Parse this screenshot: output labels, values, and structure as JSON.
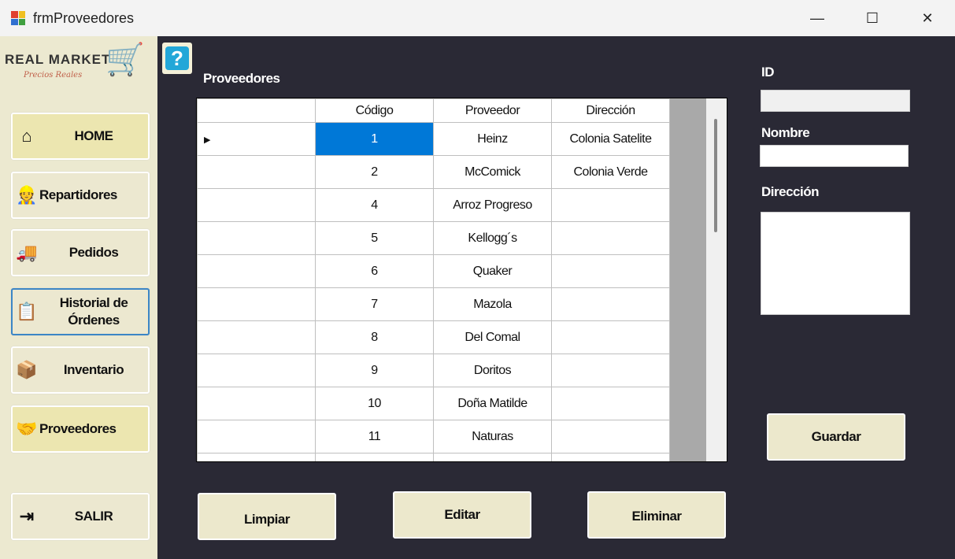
{
  "window": {
    "title": "frmProveedores",
    "minimize": "—",
    "maximize": "☐",
    "close": "✕"
  },
  "logo": {
    "brand": "REAL MARKET",
    "tagline": "Precios Reales"
  },
  "sidebar": {
    "items": [
      {
        "label": "HOME",
        "icon": "⌂"
      },
      {
        "label": "Repartidores",
        "icon": "👷"
      },
      {
        "label": "Pedidos",
        "icon": "🚚"
      },
      {
        "label": "Historial de Órdenes",
        "icon": "📋"
      },
      {
        "label": "Inventario",
        "icon": "📦"
      },
      {
        "label": "Proveedores",
        "icon": "🤝"
      },
      {
        "label": "SALIR",
        "icon": "⇥"
      }
    ]
  },
  "help": {
    "icon": "?"
  },
  "grid": {
    "title": "Proveedores",
    "columns": [
      "",
      "Código",
      "Proveedor",
      "Dirección"
    ],
    "rows": [
      [
        "1",
        "Heinz",
        "Colonia Satelite"
      ],
      [
        "2",
        "McComick",
        "Colonia Verde"
      ],
      [
        "4",
        "Arroz Progreso",
        ""
      ],
      [
        "5",
        "Kellogg´s",
        ""
      ],
      [
        "6",
        "Quaker",
        ""
      ],
      [
        "7",
        "Mazola",
        ""
      ],
      [
        "8",
        "Del Comal",
        ""
      ],
      [
        "9",
        "Doritos",
        ""
      ],
      [
        "10",
        "Doña Matilde",
        ""
      ],
      [
        "11",
        "Naturas",
        ""
      ],
      [
        "",
        "",
        ""
      ]
    ]
  },
  "form": {
    "id_label": "ID",
    "nombre_label": "Nombre",
    "direccion_label": "Dirección",
    "id_value": "",
    "nombre_value": "",
    "direccion_value": "",
    "save": "Guardar"
  },
  "actions": {
    "clear": "Limpiar",
    "edit": "Editar",
    "delete": "Eliminar"
  }
}
